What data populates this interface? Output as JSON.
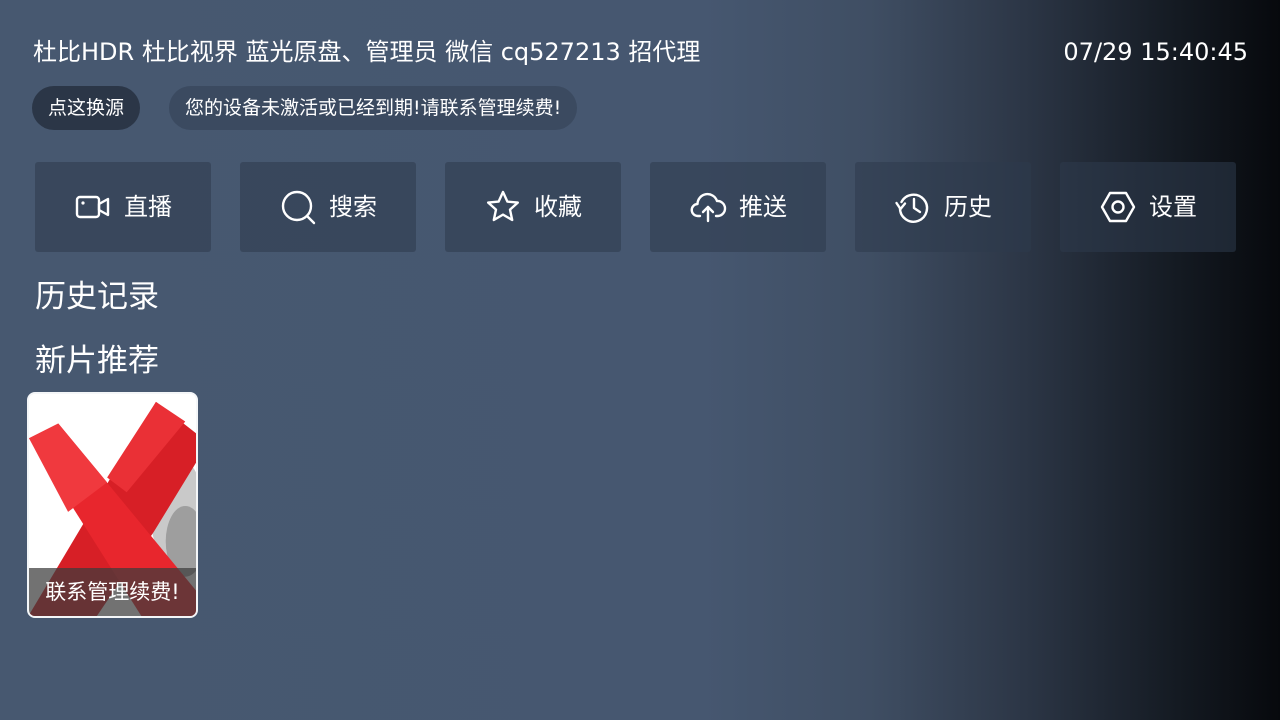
{
  "header": {
    "title": "杜比HDR 杜比视界 蓝光原盘、管理员 微信 cq527213 招代理",
    "clock": "07/29 15:40:45"
  },
  "source_button": {
    "label": "点这换源"
  },
  "notice": {
    "text": "您的设备未激活或已经到期!请联系管理续费!"
  },
  "nav": {
    "items": [
      {
        "label": "直播",
        "icon": "video-camera-icon"
      },
      {
        "label": "搜索",
        "icon": "search-icon"
      },
      {
        "label": "收藏",
        "icon": "star-icon"
      },
      {
        "label": "推送",
        "icon": "cloud-upload-icon"
      },
      {
        "label": "历史",
        "icon": "history-icon"
      },
      {
        "label": "设置",
        "icon": "settings-hexagon-icon"
      }
    ]
  },
  "sections": {
    "history_title": "历史记录",
    "recommend_title": "新片推荐"
  },
  "recommendations": [
    {
      "caption": "联系管理续费!",
      "poster_icon": "red-x-icon"
    }
  ],
  "colors": {
    "background": "#475870",
    "source_pill": "#2b3647",
    "notice_pill": "#3b4a60",
    "nav_button": "#3a475c",
    "poster_x": "#e0242a",
    "card_border": "#f4f6f8"
  }
}
